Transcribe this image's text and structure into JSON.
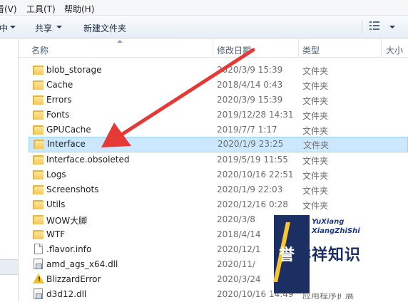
{
  "menubar": {
    "items": [
      "看(V)",
      "工具(T)",
      "帮助(H)"
    ]
  },
  "toolbar": {
    "partial_label": "中",
    "share_label": "共享",
    "new_folder_label": "新建文件夹"
  },
  "columns": {
    "name": "名称",
    "modified": "修改日期",
    "type": "类型",
    "size": "大小"
  },
  "files": [
    {
      "name": "blob_storage",
      "modified": "2020/3/9 15:39",
      "type": "文件夹",
      "icon": "folder-icon"
    },
    {
      "name": "Cache",
      "modified": "2018/4/14 0:43",
      "type": "文件夹",
      "icon": "folder-icon"
    },
    {
      "name": "Errors",
      "modified": "2020/3/9 15:39",
      "type": "文件夹",
      "icon": "folder-icon"
    },
    {
      "name": "Fonts",
      "modified": "2019/12/28 14:31",
      "type": "文件夹",
      "icon": "folder-icon"
    },
    {
      "name": "GPUCache",
      "modified": "2019/7/7 1:17",
      "type": "文件夹",
      "icon": "folder-icon"
    },
    {
      "name": "Interface",
      "modified": "2020/1/9 23:25",
      "type": "文件夹",
      "icon": "folder-icon",
      "selected": true
    },
    {
      "name": "Interface.obsoleted",
      "modified": "2019/5/19 11:55",
      "type": "文件夹",
      "icon": "folder-icon"
    },
    {
      "name": "Logs",
      "modified": "2020/10/16 22:51",
      "type": "文件夹",
      "icon": "folder-icon"
    },
    {
      "name": "Screenshots",
      "modified": "2020/1/9 22:03",
      "type": "文件夹",
      "icon": "folder-icon"
    },
    {
      "name": "Utils",
      "modified": "2020/12/16 0:28",
      "type": "文件夹",
      "icon": "folder-icon"
    },
    {
      "name": "WOW大脚",
      "modified": "2020/3/8",
      "type": "",
      "icon": "folder-icon"
    },
    {
      "name": "WTF",
      "modified": "2018/4/14",
      "type": "",
      "icon": "folder-icon"
    },
    {
      "name": ".flavor.info",
      "modified": "2020/12/1",
      "type": "",
      "icon": "file-icon"
    },
    {
      "name": "amd_ags_x64.dll",
      "modified": "2020/11/",
      "type": "",
      "icon": "dll-icon"
    },
    {
      "name": "BlizzardError",
      "modified": "2020/3/24",
      "type": "",
      "icon": "warning-icon"
    },
    {
      "name": "d3d12.dll",
      "modified": "2020/10/16 14:49",
      "type": "应用程序扩展",
      "icon": "dll-icon"
    }
  ],
  "watermark": {
    "line1": "YuXiang",
    "line2": "XiangZhiShi",
    "cn_light": "誉",
    "cn_dark": "祥祥知识"
  },
  "colors": {
    "selection": "#cce8ff",
    "arrow": "#e53935",
    "folder": "#f4c75a"
  }
}
